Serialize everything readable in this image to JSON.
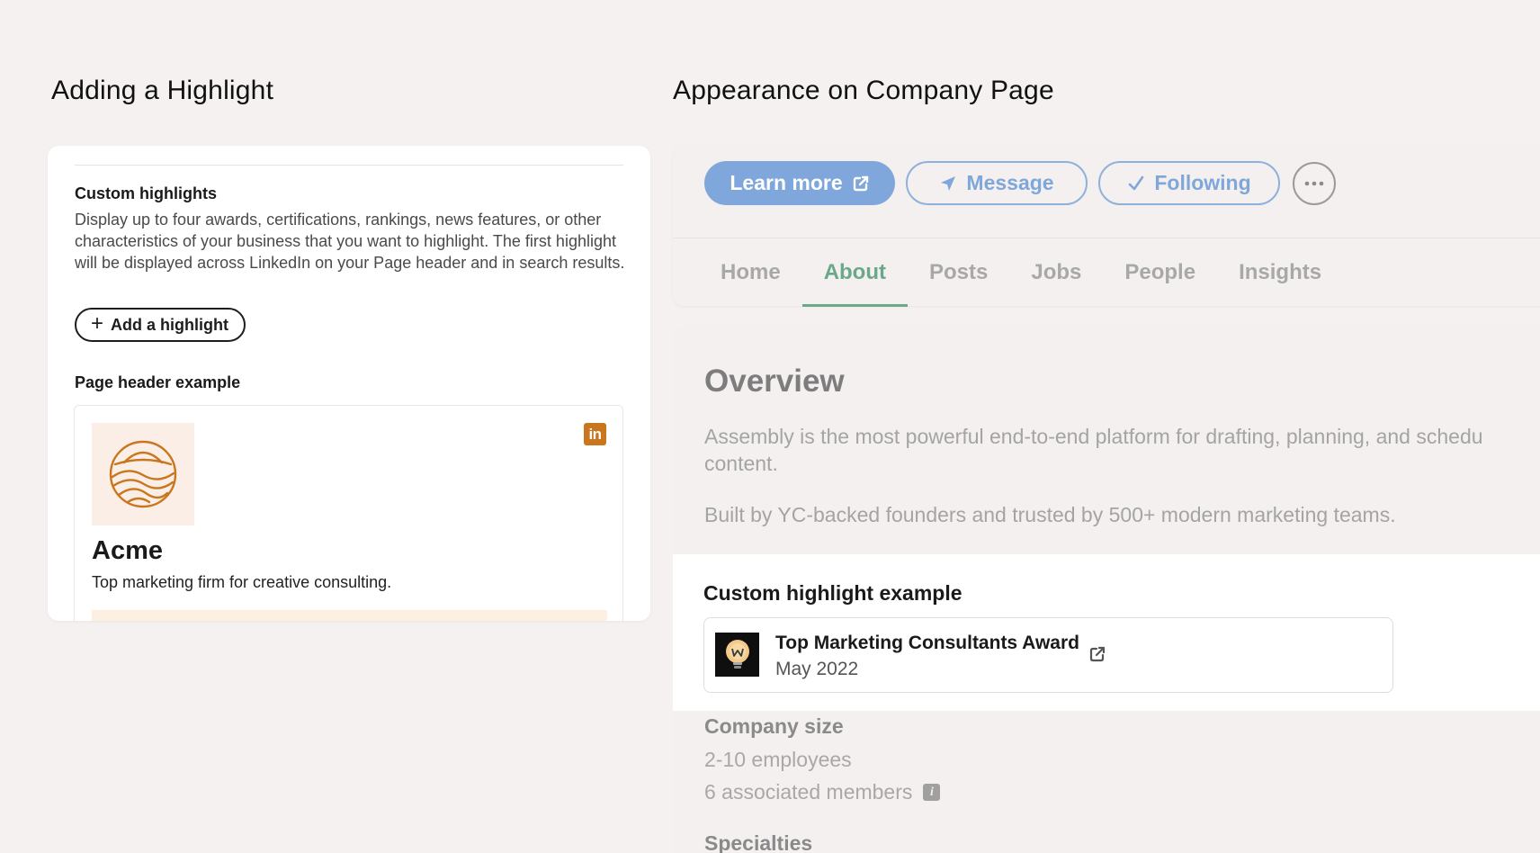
{
  "left": {
    "heading": "Adding a Highlight",
    "custom_highlights_title": "Custom highlights",
    "custom_highlights_desc": "Display up to four awards, certifications, rankings, news features, or other characteristics of your business that you want to highlight. The first highlight will be displayed across LinkedIn on your Page header and in search results.",
    "add_button_icon": "+",
    "add_button_label": "Add a highlight",
    "page_header_title": "Page header example",
    "example": {
      "company_name": "Acme",
      "tagline": "Top marketing firm for creative consulting.",
      "linkedin_badge": "in",
      "logo_icon": "sun-waves-logo-icon"
    },
    "accent_color": "#c9761f"
  },
  "right": {
    "heading": "Appearance on Company Page",
    "buttons": {
      "learn_more": "Learn more",
      "message": "Message",
      "following": "Following"
    },
    "tabs": [
      "Home",
      "About",
      "Posts",
      "Jobs",
      "People",
      "Insights"
    ],
    "active_tab": "About",
    "overview": {
      "title": "Overview",
      "line1": "Assembly is the most powerful end-to-end platform for drafting, planning, and schedu",
      "line2": "content.",
      "paragraph2": "Built by YC-backed founders and trusted by 500+ modern marketing teams."
    },
    "highlight": {
      "title": "Custom highlight example",
      "award_title": "Top Marketing Consultants Award",
      "award_date": "May 2022"
    },
    "company_size": {
      "title": "Company size",
      "value": "2-10 employees",
      "members": "6 associated members",
      "info_icon": "i"
    },
    "specialties_title": "Specialties",
    "colors": {
      "primary_button": "#7fa7db",
      "active_tab": "#6aa88a"
    }
  }
}
